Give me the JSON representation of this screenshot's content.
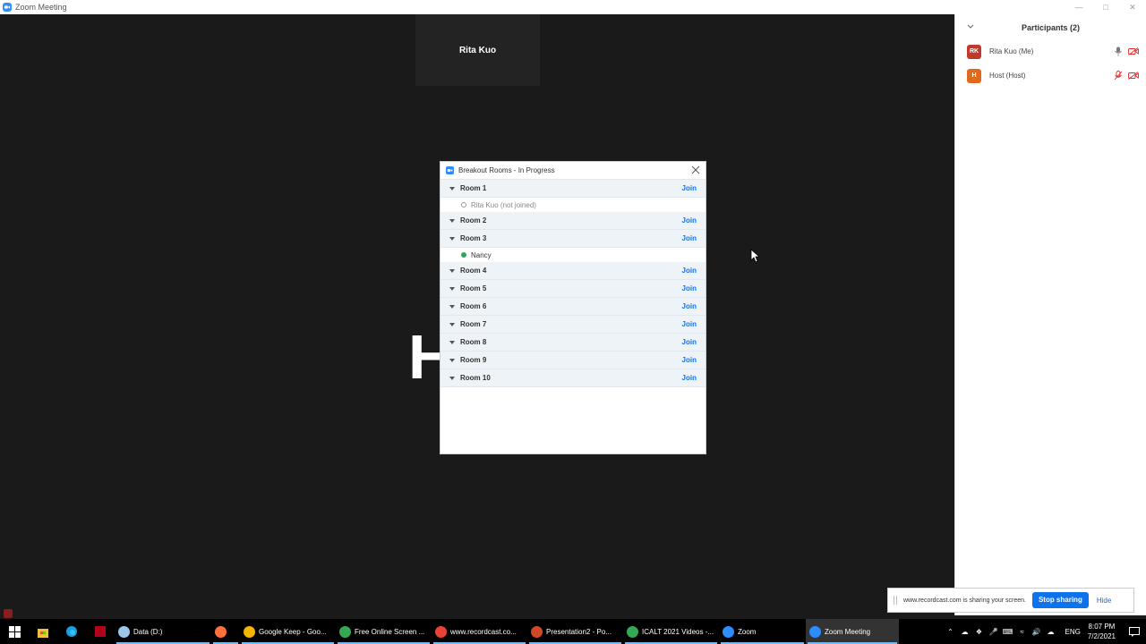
{
  "window": {
    "title": "Zoom Meeting"
  },
  "video": {
    "speaker_name": "Rita Kuo",
    "shared_glyph": "H"
  },
  "breakout": {
    "title": "Breakout Rooms - In Progress",
    "join_label": "Join",
    "rooms": [
      {
        "name": "Room 1",
        "members": [
          {
            "name": "Rita Kuo (not joined)",
            "status": "not-joined"
          }
        ]
      },
      {
        "name": "Room 2",
        "members": []
      },
      {
        "name": "Room 3",
        "members": [
          {
            "name": "Nancy",
            "status": "joined"
          }
        ]
      },
      {
        "name": "Room 4",
        "members": []
      },
      {
        "name": "Room 5",
        "members": []
      },
      {
        "name": "Room 6",
        "members": []
      },
      {
        "name": "Room 7",
        "members": []
      },
      {
        "name": "Room 8",
        "members": []
      },
      {
        "name": "Room 9",
        "members": []
      },
      {
        "name": "Room 10",
        "members": []
      }
    ]
  },
  "participants": {
    "title": "Participants (2)",
    "list": [
      {
        "initials": "RK",
        "name": "Rita Kuo (Me)",
        "avatar_color": "#c0392b",
        "mic": "on",
        "video": "off"
      },
      {
        "initials": "H",
        "name": "Host (Host)",
        "avatar_color": "#e06a1b",
        "mic": "muted",
        "video": "off"
      }
    ]
  },
  "sharing": {
    "message": "www.recordcast.com is sharing your screen.",
    "stop_label": "Stop sharing",
    "hide_label": "Hide"
  },
  "taskbar": {
    "items": [
      {
        "label": "Data (D:)",
        "icon": "drive-icon",
        "color": "#9cc7e8",
        "active": false
      },
      {
        "label": "",
        "icon": "firefox-icon",
        "color": "#ff7139",
        "active": false
      },
      {
        "label": "Google Keep - Goo...",
        "icon": "chrome-icon",
        "color": "#f4b400",
        "active": false
      },
      {
        "label": "Free Online Screen ...",
        "icon": "chrome-icon",
        "color": "#34a853",
        "active": false
      },
      {
        "label": "www.recordcast.co...",
        "icon": "chrome-icon",
        "color": "#ea4335",
        "active": false
      },
      {
        "label": "Presentation2 - Po...",
        "icon": "powerpoint-icon",
        "color": "#d24726",
        "active": false
      },
      {
        "label": "ICALT 2021 Videos -...",
        "icon": "chrome-icon",
        "color": "#34a853",
        "active": false
      },
      {
        "label": "Zoom",
        "icon": "zoom-icon",
        "color": "#2d8cff",
        "active": false
      },
      {
        "label": "Zoom Meeting",
        "icon": "zoom-icon",
        "color": "#2d8cff",
        "active": true
      }
    ],
    "language": "ENG",
    "time": "8:07 PM",
    "date": "7/2/2021"
  },
  "colors": {
    "accent": "#0e72ed",
    "zoom_blue": "#2d8cff",
    "joined_dot": "#2fa55a"
  }
}
